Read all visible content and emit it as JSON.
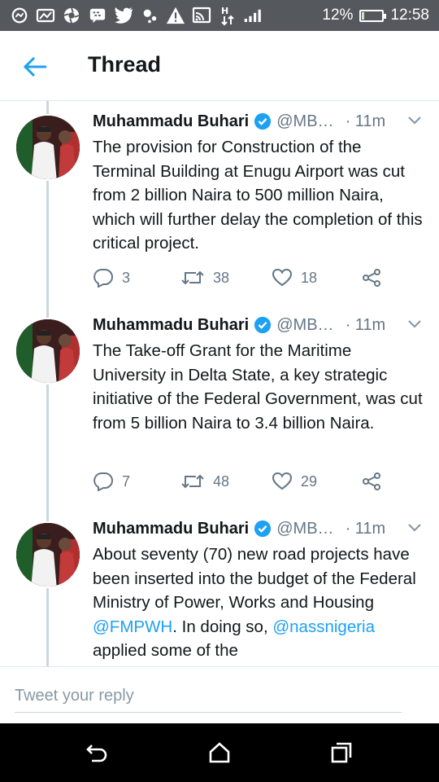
{
  "status_bar": {
    "battery": "12%",
    "battery_level": 0.12,
    "time": "12:58",
    "icons": [
      "headset-icon",
      "image-icon",
      "aperture-icon",
      "bbm-icon",
      "twitter-icon",
      "pointer-icon",
      "warning-icon",
      "cast-icon",
      "data-icon",
      "signal-icon"
    ]
  },
  "header": {
    "title": "Thread"
  },
  "colors": {
    "accent": "#1da1f2",
    "muted": "#657786",
    "statusbar": "#55595e",
    "navbar": "#000000"
  },
  "tweets": [
    {
      "name": "Muhammadu Buhari",
      "handle": "@MB…",
      "time": "· 11m",
      "text": "The provision for Construction of the Terminal Building at Enugu Airport was cut from 2 billion Naira to 500 million Naira, which will further delay the completion of this critical project.",
      "replies": "3",
      "retweets": "38",
      "likes": "18"
    },
    {
      "name": "Muhammadu Buhari",
      "handle": "@MB…",
      "time": "· 11m",
      "text": "The Take-off Grant for the Maritime University in Delta State, a key strategic initiative of the Federal Government, was cut from 5 billion Naira to 3.4 billion Naira.",
      "replies": "7",
      "retweets": "48",
      "likes": "29"
    },
    {
      "name": "Muhammadu Buhari",
      "handle": "@MB…",
      "time": "· 11m",
      "text_part1": "About seventy (70) new road projects have been inserted into the budget of the Federal Ministry of Power, Works and Housing ",
      "mention1": "@FMPWH",
      "text_part2": ". In doing so, ",
      "mention2": "@nassnigeria",
      "text_part3": " applied some of the"
    }
  ],
  "reply": {
    "placeholder": "Tweet your reply"
  }
}
